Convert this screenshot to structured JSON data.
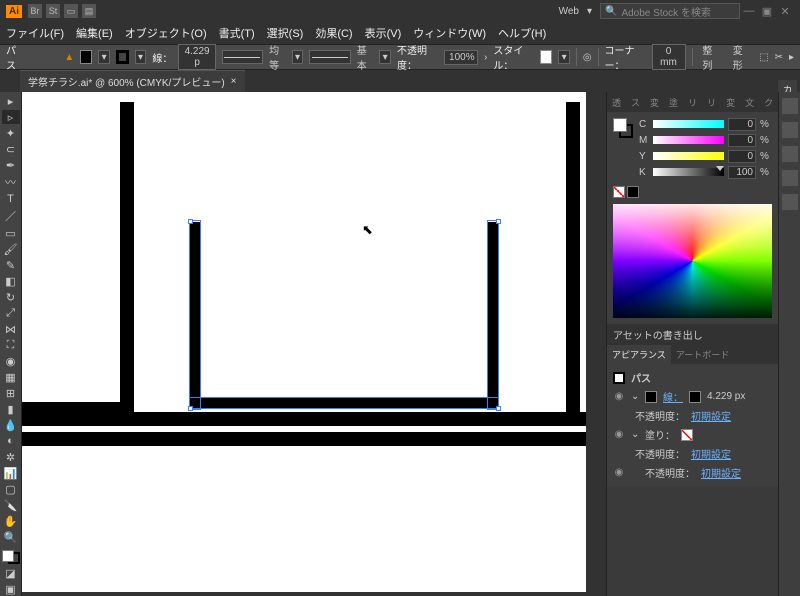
{
  "titlebar": {
    "logo": "Ai",
    "web_label": "Web",
    "search_placeholder": "Adobe Stock を検索"
  },
  "menu": {
    "file": "ファイル(F)",
    "edit": "編集(E)",
    "object": "オブジェクト(O)",
    "type": "書式(T)",
    "select": "選択(S)",
    "effect": "効果(C)",
    "view": "表示(V)",
    "window": "ウィンドウ(W)",
    "help": "ヘルプ(H)"
  },
  "control": {
    "selection_label": "パス",
    "stroke_label": "線：",
    "stroke_weight": "4.229 p",
    "profile_label": "均等",
    "brush_label": "基本",
    "opacity_label": "不透明度：",
    "opacity_value": "100%",
    "style_label": "スタイル：",
    "corner_label": "コーナー：",
    "corner_value": "0 mm",
    "align_btn": "整列",
    "transform_btn": "変形"
  },
  "tab": {
    "title": "学祭チラシ.ai* @ 600% (CMYK/プレビュー)"
  },
  "color": {
    "tabs": [
      "透",
      "ス",
      "変",
      "塗",
      "リ",
      "リ",
      "変",
      "文",
      "ク"
    ],
    "active_tab": "カラー",
    "c": {
      "label": "C",
      "value": "0",
      "unit": "%"
    },
    "m": {
      "label": "M",
      "value": "0",
      "unit": "%"
    },
    "y": {
      "label": "Y",
      "value": "0",
      "unit": "%"
    },
    "k": {
      "label": "K",
      "value": "100",
      "unit": "%"
    }
  },
  "asset_panel": {
    "title": "アセットの書き出し"
  },
  "appearance": {
    "tab_active": "アピアランス",
    "tab_other": "アートボード",
    "title": "パス",
    "stroke_label": "線：",
    "stroke_value": "4.229 px",
    "opacity_label": "不透明度：",
    "opacity_value": "初期設定",
    "fill_label": "塗り：",
    "fill_opacity_label": "不透明度：",
    "fill_opacity_value": "初期設定",
    "obj_opacity_label": "不透明度：",
    "obj_opacity_value": "初期設定"
  }
}
